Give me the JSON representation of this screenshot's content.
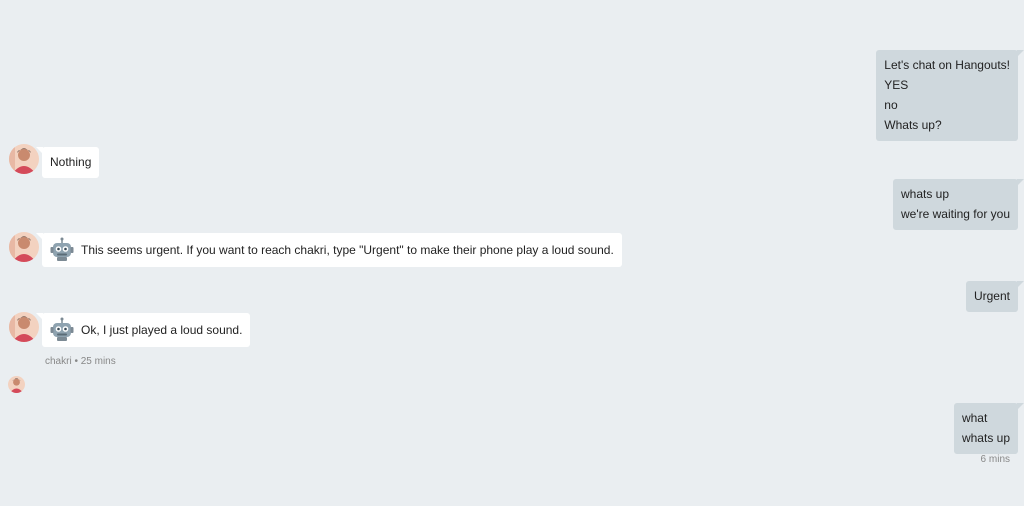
{
  "messages_out": [
    {
      "lines": [
        "Let's chat on Hangouts!",
        "YES",
        "no",
        "Whats up?"
      ]
    },
    {
      "lines": [
        "whats up",
        "we're waiting for you"
      ]
    },
    {
      "lines": [
        "Urgent"
      ]
    },
    {
      "lines": [
        "what",
        "whats up"
      ]
    }
  ],
  "messages_in": [
    {
      "text": "Nothing",
      "avatar": "user-avatar"
    },
    {
      "text": "This seems urgent. If you want to reach chakri, type \"Urgent\" to make their phone play a loud sound.",
      "avatar": "user-avatar",
      "icon": "robot-icon"
    },
    {
      "text": "Ok, I just played a loud sound.",
      "avatar": "user-avatar",
      "icon": "robot-icon"
    }
  ],
  "meta": {
    "incoming": "chakri • 25 mins",
    "outgoing": "6 mins"
  },
  "colors": {
    "background": "#eaeef1",
    "outgoing_bubble": "#cfd8dd",
    "incoming_bubble": "#ffffff"
  }
}
